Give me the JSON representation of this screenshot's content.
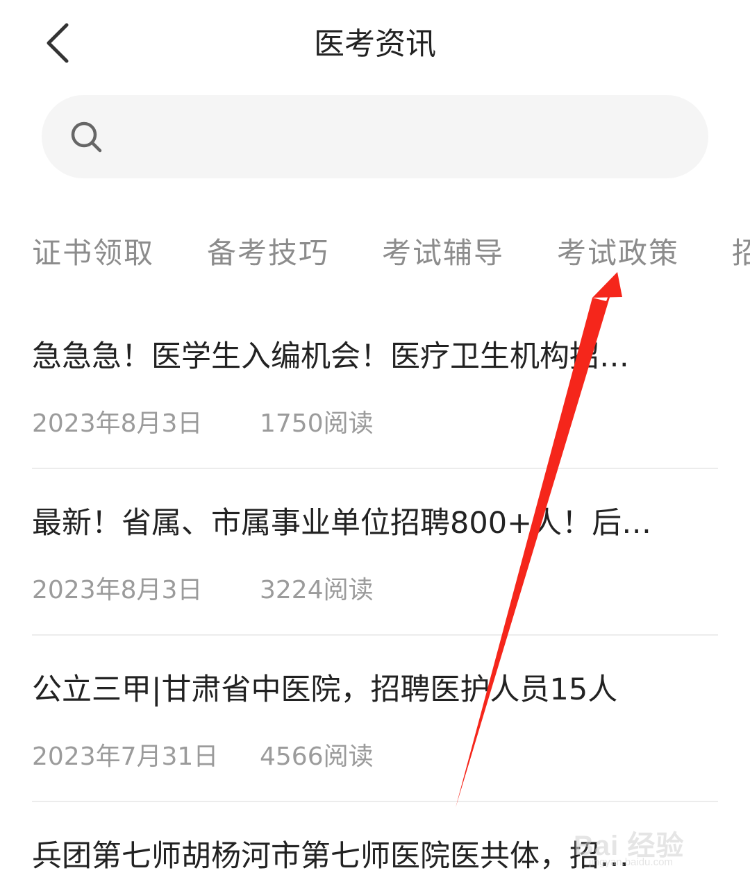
{
  "header": {
    "title": "医考资讯",
    "back_icon": "chevron-left-icon"
  },
  "search": {
    "placeholder": "",
    "icon": "search-icon"
  },
  "tabs": [
    {
      "label": "证书领取"
    },
    {
      "label": "备考技巧"
    },
    {
      "label": "考试辅导"
    },
    {
      "label": "考试政策"
    },
    {
      "label": "招"
    }
  ],
  "articles": [
    {
      "title": "急急急！医学生入编机会！医疗卫生机构招…",
      "date": "2023年8月3日",
      "reads": "1750阅读"
    },
    {
      "title": "最新！省属、市属事业单位招聘800+人！后…",
      "date": "2023年8月3日",
      "reads": "3224阅读"
    },
    {
      "title": "公立三甲|甘肃省中医院，招聘医护人员15人",
      "date": "2023年7月31日",
      "reads": "4566阅读"
    },
    {
      "title": "兵团第七师胡杨河市第七师医院医共体，招…",
      "date": "",
      "reads": ""
    }
  ],
  "watermark": {
    "brand": "Bai 经验",
    "site": "jingyan.baidu.com"
  },
  "colors": {
    "text_primary": "#222222",
    "text_secondary": "#9b9b9b",
    "tab_text": "#8c8c8c",
    "search_bg": "#f5f5f5",
    "divider": "#ececec",
    "annotation_arrow": "#f5261b"
  }
}
